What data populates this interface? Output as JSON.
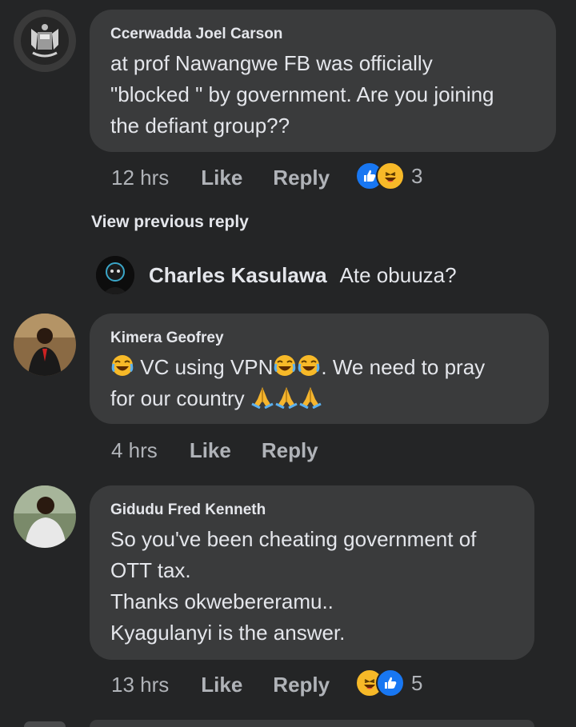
{
  "comments": [
    {
      "author": "Ccerwadda Joel Carson",
      "text": "at prof Nawangwe FB was officially\n\"blocked \" by government. Are you joining\nthe defiant group??",
      "time": "12 hrs",
      "like": "Like",
      "reply": "Reply",
      "reactions": [
        "like-icon",
        "haha-icon"
      ],
      "reaction_count": "3"
    },
    {
      "author": "Kimera Geofrey",
      "text_parts": [
        " VC using VPN",
        ". We need to pray",
        "for our country "
      ],
      "time": "4 hrs",
      "like": "Like",
      "reply": "Reply"
    },
    {
      "author": "Gidudu Fred Kenneth",
      "text": "So you've been cheating government of\nOTT tax.\nThanks okwebereramu..\nKyagulanyi is the answer.",
      "time": "13 hrs",
      "like": "Like",
      "reply": "Reply",
      "reactions": [
        "haha-icon",
        "like-icon"
      ],
      "reaction_count": "5"
    }
  ],
  "view_previous": "View previous reply",
  "collapsed_reply": {
    "author": "Charles Kasulawa",
    "text": "Ate obuuza?"
  },
  "colors": {
    "background": "#242526",
    "bubble": "#3a3b3c",
    "text": "#e4e6eb",
    "muted": "#b0b3b8",
    "like_blue": "#1877f2",
    "haha_yellow": "#f7b928"
  }
}
